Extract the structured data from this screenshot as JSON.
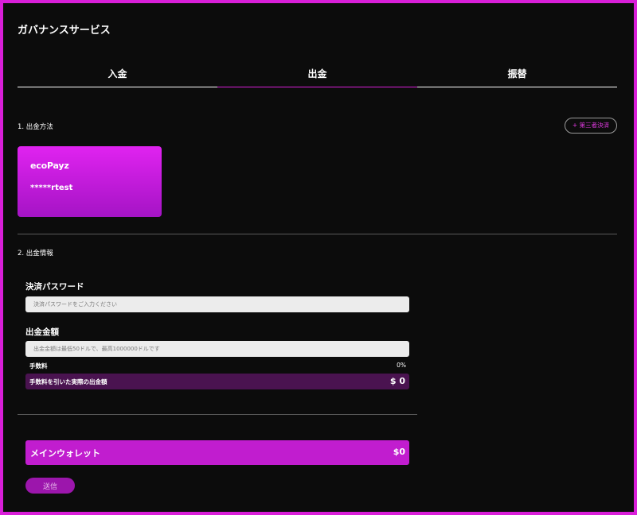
{
  "page": {
    "title": "ガバナンスサービス"
  },
  "tabs": [
    {
      "label": "入金",
      "active": false
    },
    {
      "label": "出金",
      "active": true
    },
    {
      "label": "振替",
      "active": false
    }
  ],
  "method_section": {
    "label": "1. 出金方法",
    "third_party_button": "+ 第三者決済",
    "card": {
      "brand": "ecoPayz",
      "account": "*****rtest"
    }
  },
  "info_section": {
    "label": "2. 出金情報",
    "password": {
      "label": "決済パスワード",
      "placeholder": "決済パスワードをご入力ください",
      "value": ""
    },
    "amount": {
      "label": "出金金額",
      "placeholder": "出金金額は最低50ドルで、最高1000000ドルです",
      "value": ""
    },
    "fee": {
      "label": "手数料",
      "value": "0%"
    },
    "actual": {
      "label": "手数料を引いた実際の出金額",
      "value": "$ 0"
    }
  },
  "wallet": {
    "label": "メインウォレット",
    "value": "$0"
  },
  "submit_label": "送信",
  "colors": {
    "accent": "#d91fd9",
    "background": "#0c0c0c",
    "wallet_bar": "#c11dcf",
    "actual_row": "#4a1350"
  }
}
